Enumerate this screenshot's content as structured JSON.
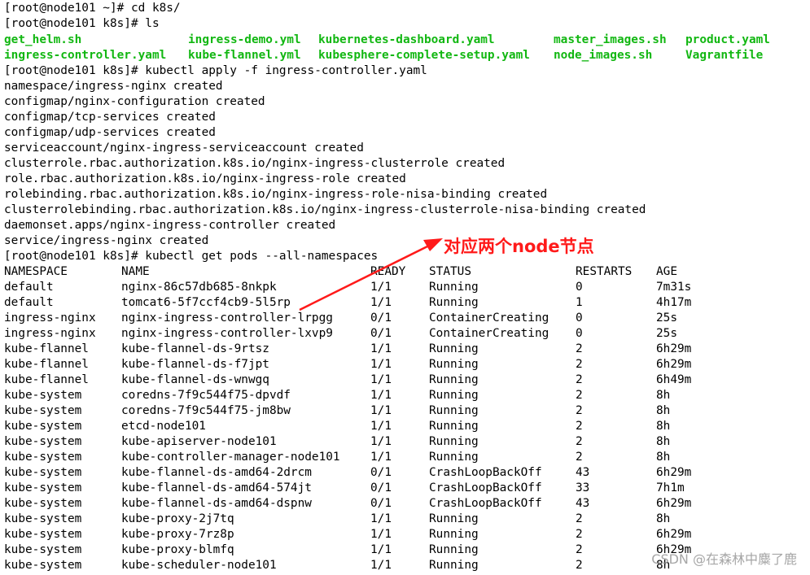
{
  "terminal": {
    "commands": {
      "cd": "[root@node101 ~]# cd k8s/",
      "ls": "[root@node101 k8s]# ls",
      "apply": "[root@node101 k8s]# kubectl apply -f ingress-controller.yaml",
      "get_pods": "[root@node101 k8s]# kubectl get pods --all-namespaces"
    },
    "ls_output": [
      [
        "get_helm.sh",
        "ingress-demo.yml",
        "kubernetes-dashboard.yaml",
        "master_images.sh",
        "product.yaml"
      ],
      [
        "ingress-controller.yaml",
        "kube-flannel.yml",
        "kubesphere-complete-setup.yaml",
        "node_images.sh",
        "Vagrantfile"
      ]
    ],
    "apply_output": [
      "namespace/ingress-nginx created",
      "configmap/nginx-configuration created",
      "configmap/tcp-services created",
      "configmap/udp-services created",
      "serviceaccount/nginx-ingress-serviceaccount created",
      "clusterrole.rbac.authorization.k8s.io/nginx-ingress-clusterrole created",
      "role.rbac.authorization.k8s.io/nginx-ingress-role created",
      "rolebinding.rbac.authorization.k8s.io/nginx-ingress-role-nisa-binding created",
      "clusterrolebinding.rbac.authorization.k8s.io/nginx-ingress-clusterrole-nisa-binding created",
      "daemonset.apps/nginx-ingress-controller created",
      "service/ingress-nginx created"
    ],
    "pods_header": [
      "NAMESPACE",
      "NAME",
      "READY",
      "STATUS",
      "RESTARTS",
      "AGE"
    ],
    "pods": [
      [
        "default",
        "nginx-86c57db685-8nkpk",
        "1/1",
        "Running",
        "0",
        "7m31s"
      ],
      [
        "default",
        "tomcat6-5f7ccf4cb9-5l5rp",
        "1/1",
        "Running",
        "1",
        "4h17m"
      ],
      [
        "ingress-nginx",
        "nginx-ingress-controller-lrpgg",
        "0/1",
        "ContainerCreating",
        "0",
        "25s"
      ],
      [
        "ingress-nginx",
        "nginx-ingress-controller-lxvp9",
        "0/1",
        "ContainerCreating",
        "0",
        "25s"
      ],
      [
        "kube-flannel",
        "kube-flannel-ds-9rtsz",
        "1/1",
        "Running",
        "2",
        "6h29m"
      ],
      [
        "kube-flannel",
        "kube-flannel-ds-f7jpt",
        "1/1",
        "Running",
        "2",
        "6h29m"
      ],
      [
        "kube-flannel",
        "kube-flannel-ds-wnwgq",
        "1/1",
        "Running",
        "2",
        "6h49m"
      ],
      [
        "kube-system",
        "coredns-7f9c544f75-dpvdf",
        "1/1",
        "Running",
        "2",
        "8h"
      ],
      [
        "kube-system",
        "coredns-7f9c544f75-jm8bw",
        "1/1",
        "Running",
        "2",
        "8h"
      ],
      [
        "kube-system",
        "etcd-node101",
        "1/1",
        "Running",
        "2",
        "8h"
      ],
      [
        "kube-system",
        "kube-apiserver-node101",
        "1/1",
        "Running",
        "2",
        "8h"
      ],
      [
        "kube-system",
        "kube-controller-manager-node101",
        "1/1",
        "Running",
        "2",
        "8h"
      ],
      [
        "kube-system",
        "kube-flannel-ds-amd64-2drcm",
        "0/1",
        "CrashLoopBackOff",
        "43",
        "6h29m"
      ],
      [
        "kube-system",
        "kube-flannel-ds-amd64-574jt",
        "0/1",
        "CrashLoopBackOff",
        "33",
        "7h1m"
      ],
      [
        "kube-system",
        "kube-flannel-ds-amd64-dspnw",
        "0/1",
        "CrashLoopBackOff",
        "43",
        "6h29m"
      ],
      [
        "kube-system",
        "kube-proxy-2j7tq",
        "1/1",
        "Running",
        "2",
        "8h"
      ],
      [
        "kube-system",
        "kube-proxy-7rz8p",
        "1/1",
        "Running",
        "2",
        "6h29m"
      ],
      [
        "kube-system",
        "kube-proxy-blmfq",
        "1/1",
        "Running",
        "2",
        "6h29m"
      ],
      [
        "kube-system",
        "kube-scheduler-node101",
        "1/1",
        "Running",
        "2",
        "8h"
      ]
    ]
  },
  "annotation": {
    "text": "对应两个node节点",
    "color": "#ff1a1a"
  },
  "watermark": "CSDN @在森林中麋了鹿",
  "colors": {
    "background": "#ffffff",
    "text": "#000000",
    "executable_file": "#12b712"
  }
}
